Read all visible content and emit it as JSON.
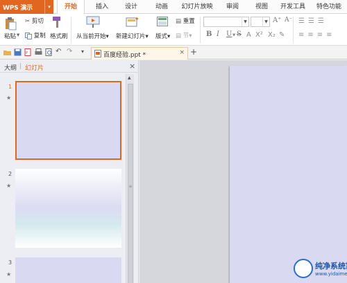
{
  "app": {
    "name": "WPS 演示",
    "caret": "▾"
  },
  "tabs": [
    {
      "label": "开始"
    },
    {
      "label": "插入"
    },
    {
      "label": "设计"
    },
    {
      "label": "动画"
    },
    {
      "label": "幻灯片放映"
    },
    {
      "label": "审阅"
    },
    {
      "label": "视图"
    },
    {
      "label": "开发工具"
    },
    {
      "label": "特色功能"
    }
  ],
  "ribbon": {
    "paste": "粘贴",
    "cut": "剪切",
    "copy": "复制",
    "format_painter": "格式刷",
    "from_current": "从当前开始",
    "new_slide": "新建幻灯片",
    "layout": "版式",
    "reset": "重置",
    "section": "节",
    "bold": "B",
    "italic": "I",
    "underline": "U",
    "strike": "S",
    "grow": "A⁺",
    "shrink": "A⁻"
  },
  "doc_tab": {
    "name": "百度经验.ppt *",
    "close": "×",
    "new": "+"
  },
  "panel": {
    "outline": "大纲",
    "separator": "|",
    "slides": "幻灯片",
    "close": "×",
    "slide_numbers": [
      "1",
      "2",
      "3"
    ]
  },
  "watermark": {
    "title": "纯净系统家园",
    "url": "www.yidaimei.com"
  },
  "colors": {
    "accent": "#e2661f",
    "slide_bg": "#d9d9f2",
    "brand_blue": "#1f56a8"
  }
}
